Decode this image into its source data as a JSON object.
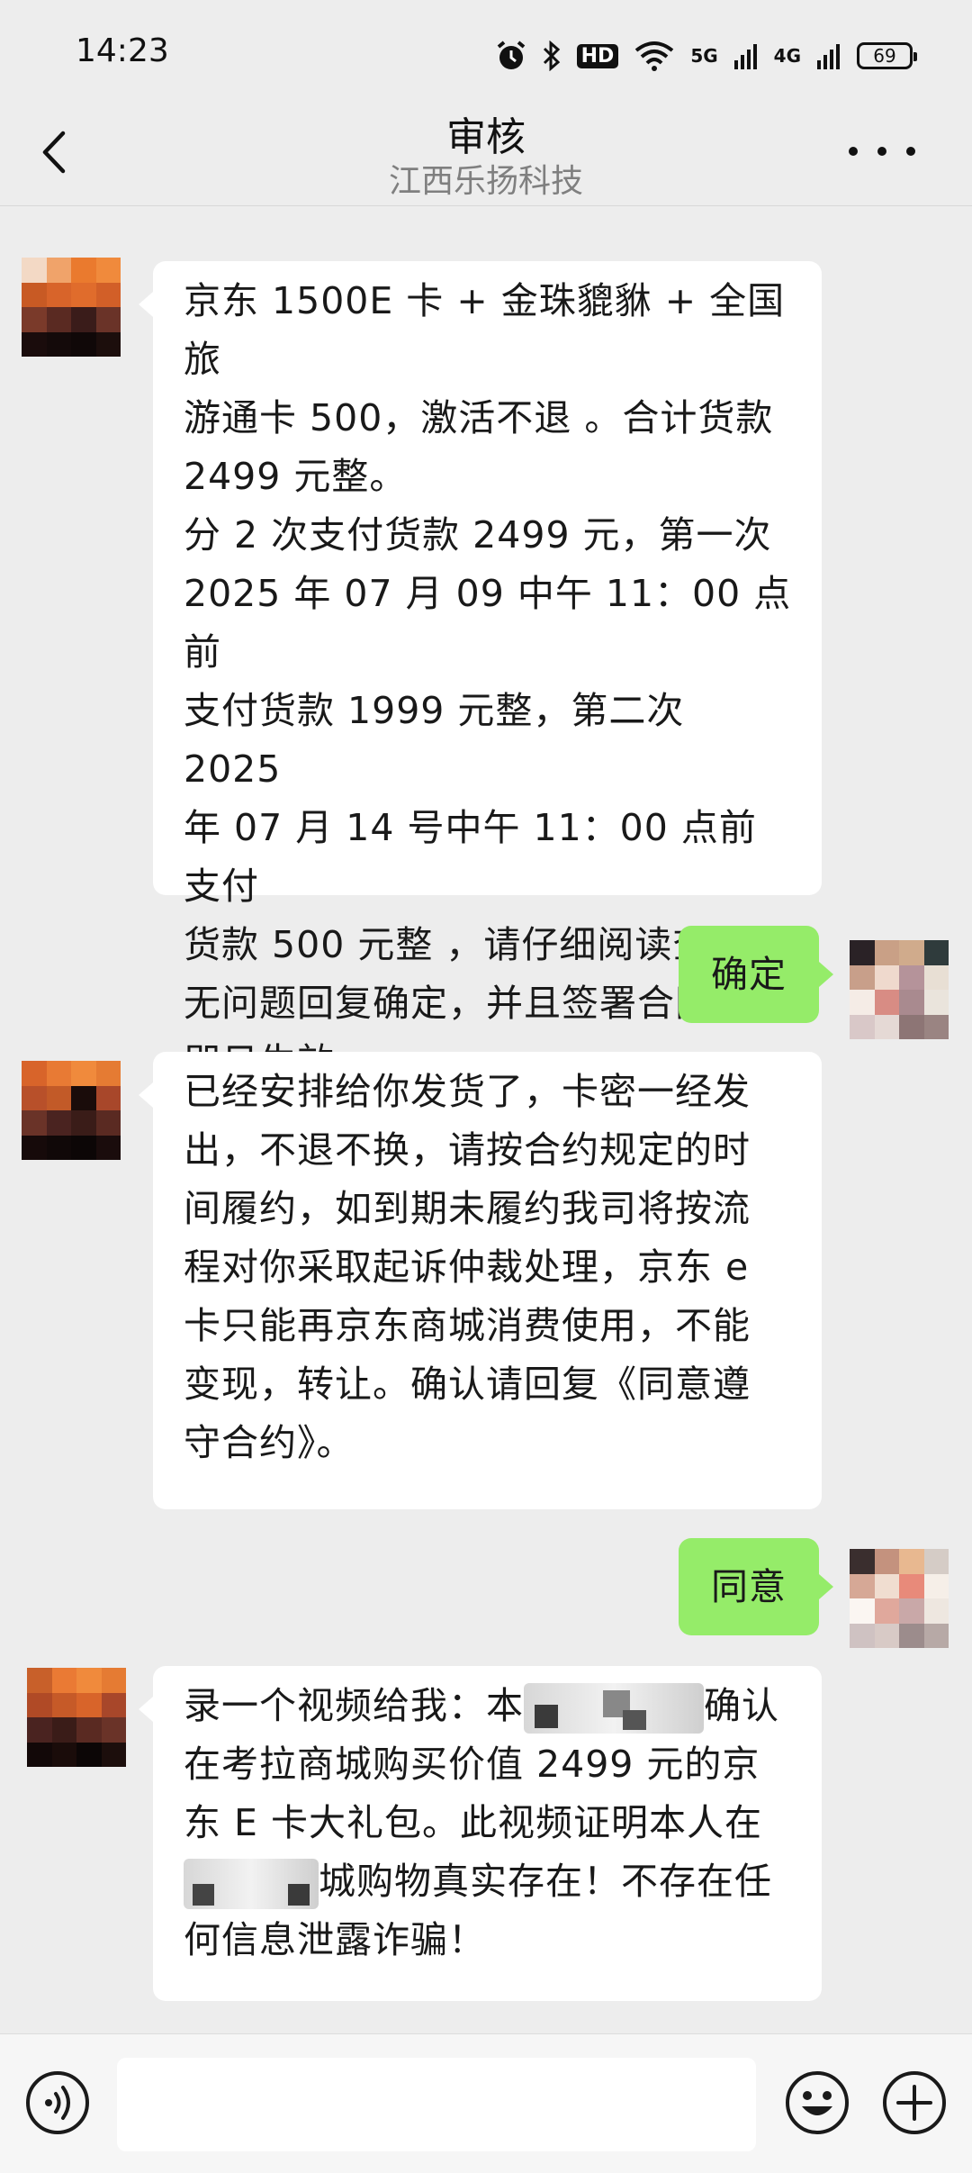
{
  "status_bar": {
    "time": "14:23",
    "hd_label": "HD",
    "network_1": "5G",
    "network_2": "4G",
    "battery": "69"
  },
  "header": {
    "title": "审核",
    "subtitle": "江西乐扬科技"
  },
  "messages": [
    {
      "side": "left",
      "text": "京东 1500E 卡 + 金珠貔貅 + 全国旅\n游通卡 500，激活不退 。合计货款\n2499 元整。\n分 2 次支付货款 2499 元，第一次\n2025 年 07 月 09 中午 11：00 点前\n支付货款 1999 元整，第二次 2025\n年 07 月 14 号中午 11：00 点前支付\n货款 500 元整 ，请仔细阅读查看，\n无问题回复确定，并且签署合同，\n即日生效。"
    },
    {
      "side": "right",
      "text": "确定"
    },
    {
      "side": "left",
      "text": "已经安排给你发货了，卡密一经发\n出，不退不换，请按合约规定的时\n间履约，如到期未履约我司将按流\n程对你采取起诉仲裁处理，京东 e\n卡只能再京东商城消费使用，不能\n变现，转让。确认请回复《同意遵\n守合约》。"
    },
    {
      "side": "right",
      "text": "同意"
    },
    {
      "side": "left",
      "line1_a": "录一个视频给我：本",
      "line1_b": "确认",
      "line2": "在考拉商城购买价值 2499 元的京",
      "line3": "东 E 卡大礼包。此视频证明本人在",
      "line4_b": "城购物真实存在！不存在任",
      "line5": "何信息泄露诈骗！"
    }
  ],
  "icons": {
    "back": "chevron-left-icon",
    "more": "more-dots-icon",
    "voice": "voice-icon",
    "emoji": "emoji-icon",
    "plus": "plus-icon"
  },
  "colors": {
    "background": "#ededed",
    "sent_bubble": "#95ec69",
    "received_bubble": "#ffffff"
  }
}
